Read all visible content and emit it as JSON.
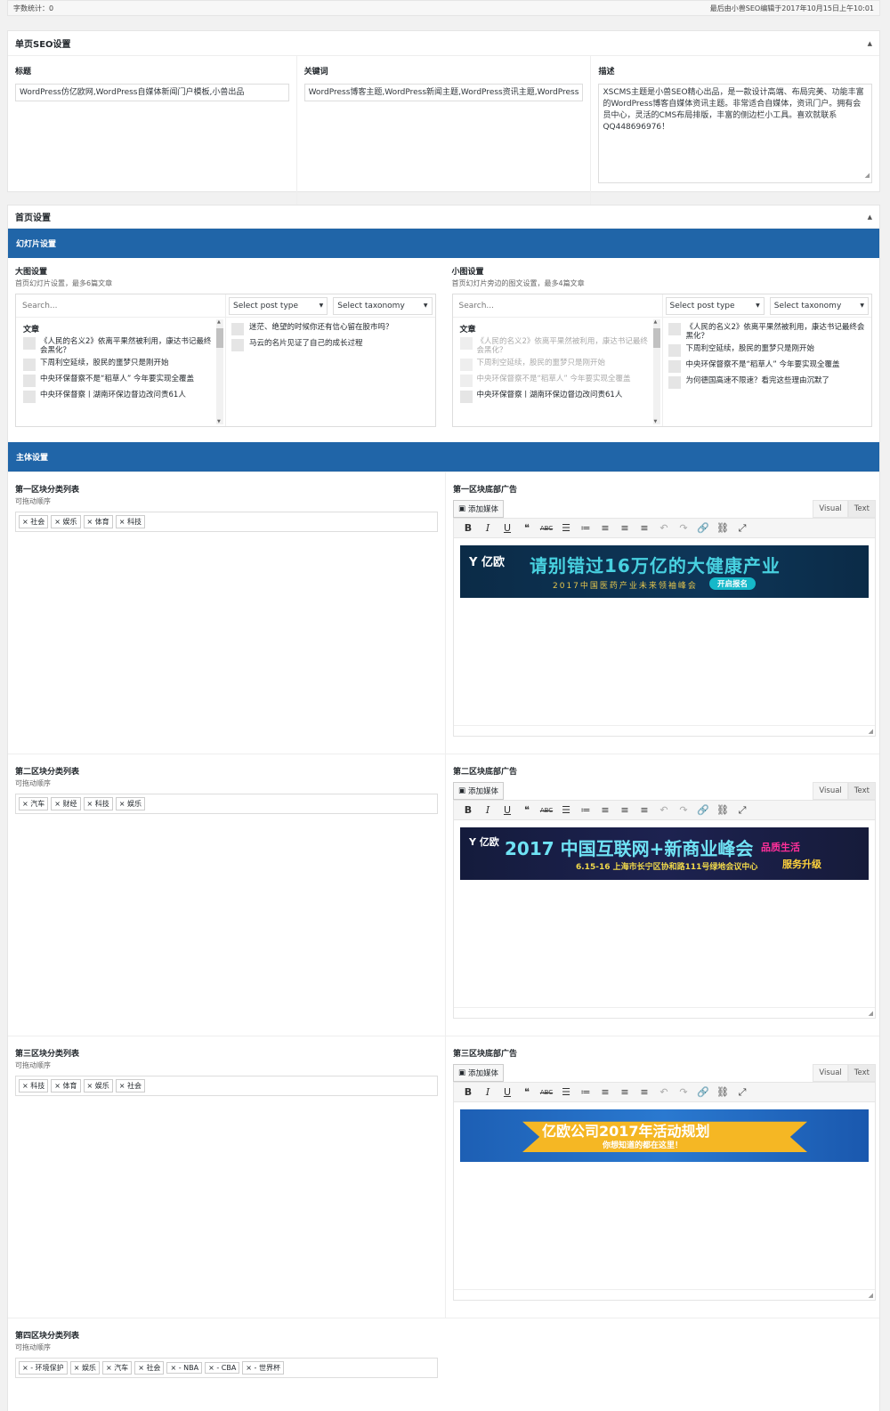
{
  "statusbar": {
    "word_count": "字数统计：0",
    "last_edit": "最后由小兽SEO编辑于2017年10月15日上午10:01"
  },
  "seo": {
    "title": "单页SEO设置",
    "fields": [
      {
        "label": "标题",
        "value": "WordPress仿亿欧网,WordPress自媒体新闻门户模板,小兽出品"
      },
      {
        "label": "关键词",
        "value": "WordPress博客主题,WordPress新闻主题,WordPress资讯主题,WordPress"
      },
      {
        "label": "描述",
        "value": "XSCMS主题是小兽SEO精心出品，是一款设计高端、布局完美、功能丰富的WordPress博客自媒体资讯主题。非常适合自媒体，资讯门户。拥有会员中心，灵活的CMS布局排版，丰富的侧边栏小工具。喜欢就联系QQ448696976！"
      }
    ]
  },
  "home": {
    "title": "首页设置",
    "slides_band": "幻灯片设置",
    "main_band": "主体设置",
    "slides": [
      {
        "title": "大图设置",
        "sub": "首页幻灯片设置，最多6篇文章",
        "search_placeholder": "Search...",
        "post_type": "Select post type",
        "taxonomy": "Select taxonomy",
        "list_heading": "文章",
        "posts": [
          "《人民的名义2》依离平果然被利用，康达书记最终会黑化？",
          "下周利空延续，股民的噩梦只是刚开始",
          "中央环保督察不是“稻草人” 今年要实现全覆盖",
          "中央环保督察丨湖南环保边督边改问责61人"
        ],
        "selected": [
          "迷茫、绝望的时候你还有信心留在股市吗？",
          "马云的名片见证了自己的成长过程"
        ]
      },
      {
        "title": "小图设置",
        "sub": "首页幻灯片旁边的图文设置，最多4篇文章",
        "search_placeholder": "Search...",
        "post_type": "Select post type",
        "taxonomy": "Select taxonomy",
        "list_heading": "文章",
        "posts": [
          "《人民的名义2》依离平果然被利用，康达书记最终会黑化？",
          "下周利空延续，股民的噩梦只是刚开始",
          "中央环保督察不是“稻草人” 今年要实现全覆盖",
          "中央环保督察丨湖南环保边督边改问责61人"
        ],
        "selected": [
          "《人民的名义2》依离平果然被利用，康达书记最终会黑化？",
          "下周利空延续，股民的噩梦只是刚开始",
          "中央环保督察不是“稻草人” 今年要实现全覆盖",
          "为何德国高速不限速？看完这些理由沉默了"
        ]
      }
    ],
    "sections": [
      {
        "list_title": "第一区块分类列表",
        "drag": "可拖动顺序",
        "tags": [
          "社会",
          "娱乐",
          "体育",
          "科技"
        ],
        "ad_title": "第一区块底部广告"
      },
      {
        "list_title": "第二区块分类列表",
        "drag": "可拖动顺序",
        "tags": [
          "汽车",
          "财经",
          "科技",
          "娱乐"
        ],
        "ad_title": "第二区块底部广告"
      },
      {
        "list_title": "第三区块分类列表",
        "drag": "可拖动顺序",
        "tags": [
          "科技",
          "体育",
          "娱乐",
          "社会"
        ],
        "ad_title": "第三区块底部广告"
      },
      {
        "list_title": "第四区块分类列表",
        "drag": "可拖动顺序",
        "tags": [
          "- 环境保护",
          "娱乐",
          "汽车",
          "社会",
          "- NBA",
          "- CBA",
          "- 世界杯"
        ]
      }
    ],
    "editor": {
      "add_media": "添加媒体",
      "tab_visual": "Visual",
      "tab_text": "Text"
    },
    "banners": [
      {
        "logo": "亿欧",
        "main": "请别错过16万亿的大健康产业",
        "sub": "2017中国医药产业未来领袖峰会",
        "button": "开启报名"
      },
      {
        "logo": "亿欧",
        "main": "2017 中国互联网+新商业峰会",
        "sub": "6.15-16  上海市长宁区协和路111号绿地会议中心",
        "r1": "品质生活",
        "r2": "服务升级"
      },
      {
        "main": "亿欧公司2017年活动规划",
        "sub": "你想知道的都在这里！"
      }
    ]
  }
}
